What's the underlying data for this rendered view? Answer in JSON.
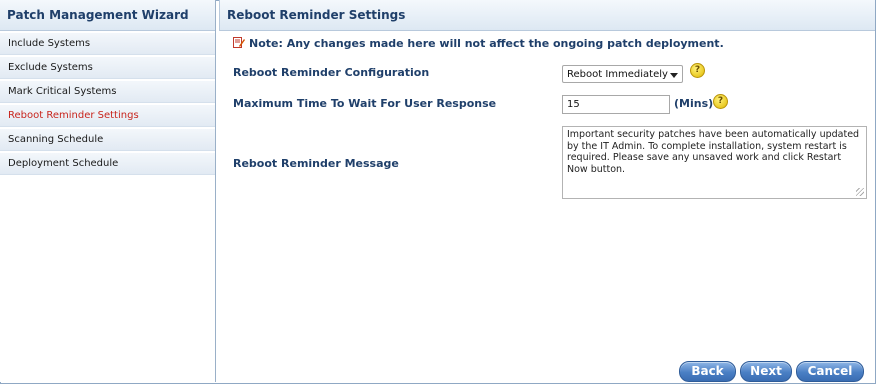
{
  "sidebar": {
    "title": "Patch Management Wizard",
    "items": [
      {
        "label": "Include Systems"
      },
      {
        "label": "Exclude Systems"
      },
      {
        "label": "Mark Critical Systems"
      },
      {
        "label": "Reboot Reminder Settings",
        "active": true
      },
      {
        "label": "Scanning Schedule"
      },
      {
        "label": "Deployment Schedule"
      }
    ]
  },
  "main": {
    "title": "Reboot Reminder Settings",
    "note": "Note: Any changes made here will not affect the ongoing patch deployment.",
    "config": {
      "label": "Reboot Reminder Configuration",
      "value": "Reboot Immediately",
      "help_icon": "help-icon"
    },
    "wait": {
      "label": "Maximum Time To Wait For User Response",
      "value": "15",
      "unit": "(Mins)",
      "help_icon": "help-icon"
    },
    "message": {
      "label": "Reboot Reminder Message",
      "value": "Important security patches have been automatically updated by the IT Admin. To complete installation, system restart is required. Please save any unsaved work and click Restart Now button."
    }
  },
  "buttons": {
    "back": "Back",
    "next": "Next",
    "cancel": "Cancel"
  },
  "colors": {
    "heading": "#1f3f6a",
    "active_item": "#c8251d",
    "button": "#4a7fc4"
  }
}
